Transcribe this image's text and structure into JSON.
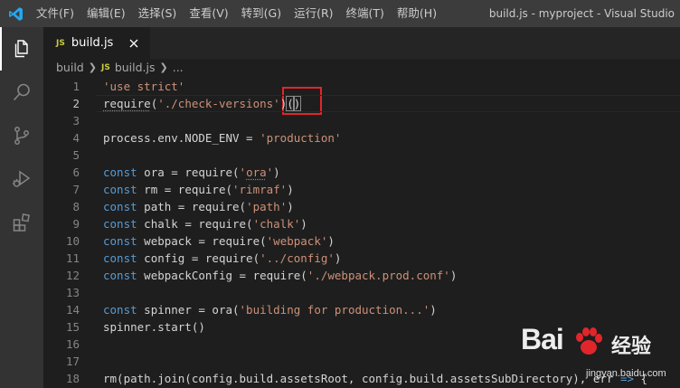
{
  "menu": [
    "文件(F)",
    "编辑(E)",
    "选择(S)",
    "查看(V)",
    "转到(G)",
    "运行(R)",
    "终端(T)",
    "帮助(H)"
  ],
  "window_title": "build.js - myproject - Visual Studio",
  "tab": {
    "badge": "JS",
    "label": "build.js"
  },
  "breadcrumb": {
    "folder": "build",
    "badge": "JS",
    "file": "build.js",
    "more": "..."
  },
  "code": [
    {
      "n": "1",
      "tokens": [
        {
          "t": "'use strict'",
          "c": "str"
        }
      ]
    },
    {
      "n": "2",
      "current": true,
      "tokens": [
        {
          "t": "require",
          "c": "plain",
          "sq": true
        },
        {
          "t": "(",
          "c": "plain"
        },
        {
          "t": "'./check-versions'",
          "c": "str"
        },
        {
          "t": ")",
          "c": "plain"
        },
        {
          "t": "(",
          "c": "plain",
          "cur": true
        },
        {
          "t": ")",
          "c": "plain",
          "cur": true
        }
      ]
    },
    {
      "n": "3",
      "tokens": []
    },
    {
      "n": "4",
      "tokens": [
        {
          "t": "process.env.NODE_ENV = ",
          "c": "plain"
        },
        {
          "t": "'production'",
          "c": "str"
        }
      ]
    },
    {
      "n": "5",
      "tokens": []
    },
    {
      "n": "6",
      "tokens": [
        {
          "t": "const",
          "c": "kw"
        },
        {
          "t": " ora = require(",
          "c": "plain"
        },
        {
          "t": "'",
          "c": "str"
        },
        {
          "t": "ora",
          "c": "str",
          "sq": true
        },
        {
          "t": "'",
          "c": "str"
        },
        {
          "t": ")",
          "c": "plain"
        }
      ]
    },
    {
      "n": "7",
      "tokens": [
        {
          "t": "const",
          "c": "kw"
        },
        {
          "t": " rm = require(",
          "c": "plain"
        },
        {
          "t": "'rimraf'",
          "c": "str"
        },
        {
          "t": ")",
          "c": "plain"
        }
      ]
    },
    {
      "n": "8",
      "tokens": [
        {
          "t": "const",
          "c": "kw"
        },
        {
          "t": " path = require(",
          "c": "plain"
        },
        {
          "t": "'path'",
          "c": "str"
        },
        {
          "t": ")",
          "c": "plain"
        }
      ]
    },
    {
      "n": "9",
      "tokens": [
        {
          "t": "const",
          "c": "kw"
        },
        {
          "t": " chalk = require(",
          "c": "plain"
        },
        {
          "t": "'chalk'",
          "c": "str"
        },
        {
          "t": ")",
          "c": "plain"
        }
      ]
    },
    {
      "n": "10",
      "tokens": [
        {
          "t": "const",
          "c": "kw"
        },
        {
          "t": " webpack = require(",
          "c": "plain"
        },
        {
          "t": "'webpack'",
          "c": "str"
        },
        {
          "t": ")",
          "c": "plain"
        }
      ]
    },
    {
      "n": "11",
      "tokens": [
        {
          "t": "const",
          "c": "kw"
        },
        {
          "t": " config = require(",
          "c": "plain"
        },
        {
          "t": "'../config'",
          "c": "str"
        },
        {
          "t": ")",
          "c": "plain"
        }
      ]
    },
    {
      "n": "12",
      "tokens": [
        {
          "t": "const",
          "c": "kw"
        },
        {
          "t": " webpackConfig = require(",
          "c": "plain"
        },
        {
          "t": "'./webpack.prod.conf'",
          "c": "str"
        },
        {
          "t": ")",
          "c": "plain"
        }
      ]
    },
    {
      "n": "13",
      "tokens": []
    },
    {
      "n": "14",
      "tokens": [
        {
          "t": "const",
          "c": "kw"
        },
        {
          "t": " spinner = ora(",
          "c": "plain"
        },
        {
          "t": "'building for production...'",
          "c": "str"
        },
        {
          "t": ")",
          "c": "plain"
        }
      ]
    },
    {
      "n": "15",
      "tokens": [
        {
          "t": "spinner.start()",
          "c": "plain"
        }
      ]
    },
    {
      "n": "16",
      "tokens": []
    },
    {
      "n": "17",
      "tokens": []
    },
    {
      "n": "18",
      "tokens": [
        {
          "t": "rm(path.join(config.build.assetsRoot, config.build.assetsSubDirectory), err ",
          "c": "plain"
        },
        {
          "t": "=>",
          "c": "kw"
        },
        {
          "t": " {",
          "c": "plain"
        }
      ]
    }
  ],
  "watermark": {
    "brand": "Bai",
    "cn": "经验",
    "url": "jingyan.baidu.com"
  },
  "colors": {
    "keyword": "#569cd6",
    "string": "#ce9178",
    "text": "#d4d4d4",
    "highlight": "#e0262b",
    "js_badge": "#cbcb41"
  }
}
